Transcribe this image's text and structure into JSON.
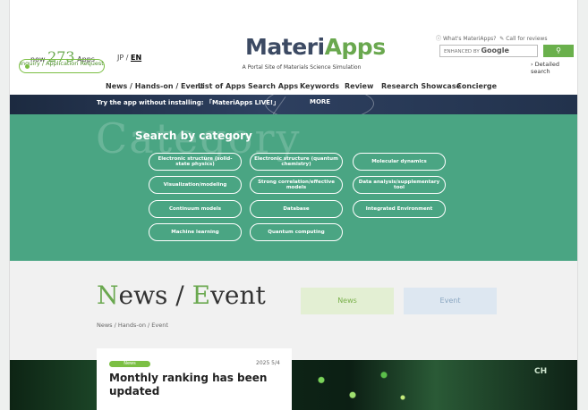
{
  "header": {
    "count_prefix": "now",
    "count_value": "273",
    "count_suffix": "Apps",
    "inquiry_label": "Inquiry / Application Request",
    "lang_jp": "JP",
    "lang_sep": "/",
    "lang_en": "EN",
    "logo_part1": "Materi",
    "logo_part2": "Apps",
    "tagline": "A Portal Site of Materials Science Simulation",
    "whats_link": "What's MateriApps?",
    "call_link": "Call for reviews",
    "search_prefix": "ENHANCED BY",
    "search_brand": "Google",
    "detailed_search": "Detailed search"
  },
  "nav": {
    "items": [
      "News / Hands-on / Event",
      "List of Apps",
      "Search Apps",
      "Keywords",
      "Review",
      "Research Showcase",
      "Concierge"
    ]
  },
  "strip": {
    "try_text": "Try the app without installing: 「MateriApps LIVE!」",
    "more_label": "MORE"
  },
  "category": {
    "bg_text": "Category",
    "title": "Search by category",
    "items": [
      "Electronic structure (solid-state physics)",
      "Electronic structure (quantum chemistry)",
      "Molecular dynamics",
      "Visualization/modeling",
      "Strong correlation/effective models",
      "Data analysis/supplementary tool",
      "Continuum models",
      "Database",
      "Integrated Environment",
      "Machine learning",
      "Quantum computing"
    ]
  },
  "news": {
    "title_n": "N",
    "title_rest1": "ews / ",
    "title_e": "E",
    "title_rest2": "vent",
    "tab_news": "News",
    "tab_event": "Event",
    "breadcrumb": "News / Hands-on / Event",
    "card": {
      "badge": "News",
      "date": "2025 5/4",
      "headline": "Monthly ranking has been updated"
    },
    "banner_text": "CH"
  },
  "colors": {
    "brand_green": "#6aa84f",
    "category_bg": "#4aa583",
    "logo_dark": "#3c4a63"
  }
}
